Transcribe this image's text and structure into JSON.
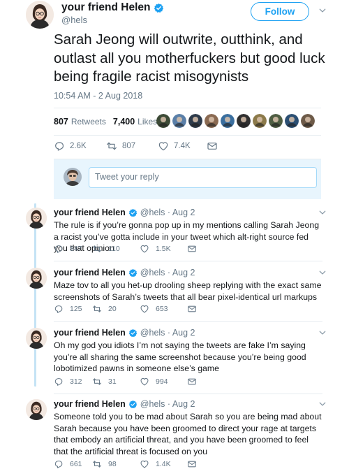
{
  "main": {
    "name": "your friend Helen",
    "handle": "@hels",
    "follow_label": "Follow",
    "text": "Sarah Jeong will outwrite, outthink, and outlast all you motherfuckers but good luck being fragile racist misogynists",
    "timestamp": "10:54 AM - 2 Aug 2018",
    "retweets_count": "807",
    "retweets_label": "Retweets",
    "likes_count": "7,400",
    "likes_label": "Likes",
    "liker_colors": [
      "#3c4a36",
      "#5a7fa8",
      "#2d3a4a",
      "#8a6a52",
      "#3a6e9e",
      "#2f2f2f",
      "#8c7a4a",
      "#4e5d42",
      "#2b4f73",
      "#6d5a48"
    ],
    "replies": "2.6K",
    "retweets": "807",
    "likes": "7.4K",
    "reply_placeholder": "Tweet your reply"
  },
  "thread": [
    {
      "name": "your friend Helen",
      "meta": "@hels · Aug 2",
      "text": "The rule is if you’re gonna pop up in my mentions calling Sarah Jeong a racist you’ve gotta include in your tweet which alt-right source fed you that opinion",
      "replies": "847",
      "retweets": "110",
      "likes": "1.5K"
    },
    {
      "name": "your friend Helen",
      "meta": "@hels · Aug 2",
      "text": "Maze tov to all you het-up drooling sheep replying with the exact same screenshots of Sarah’s tweets that all bear pixel-identical url markups",
      "replies": "125",
      "retweets": "20",
      "likes": "653"
    },
    {
      "name": "your friend Helen",
      "meta": "@hels · Aug 2",
      "text": "Oh my god you idiots I’m not saying the tweets are fake I’m saying you’re all sharing the same screenshot because you’re being good lobotimized pawns in someone else’s game",
      "replies": "312",
      "retweets": "31",
      "likes": "994"
    },
    {
      "name": "your friend Helen",
      "meta": "@hels · Aug 2",
      "text": "Someone told you to be mad about Sarah so you are being mad about Sarah because you have been groomed to direct your rage at targets that embody an artificial threat, and you have been groomed to feel that the artificial threat is focused on you",
      "replies": "661",
      "retweets": "98",
      "likes": "1.4K"
    }
  ],
  "colors": {
    "accent": "#1da1f2",
    "muted": "#657786",
    "text": "#14171a",
    "thread_line": "#c4e3f5",
    "reply_box_bg": "#e8f5fd"
  }
}
